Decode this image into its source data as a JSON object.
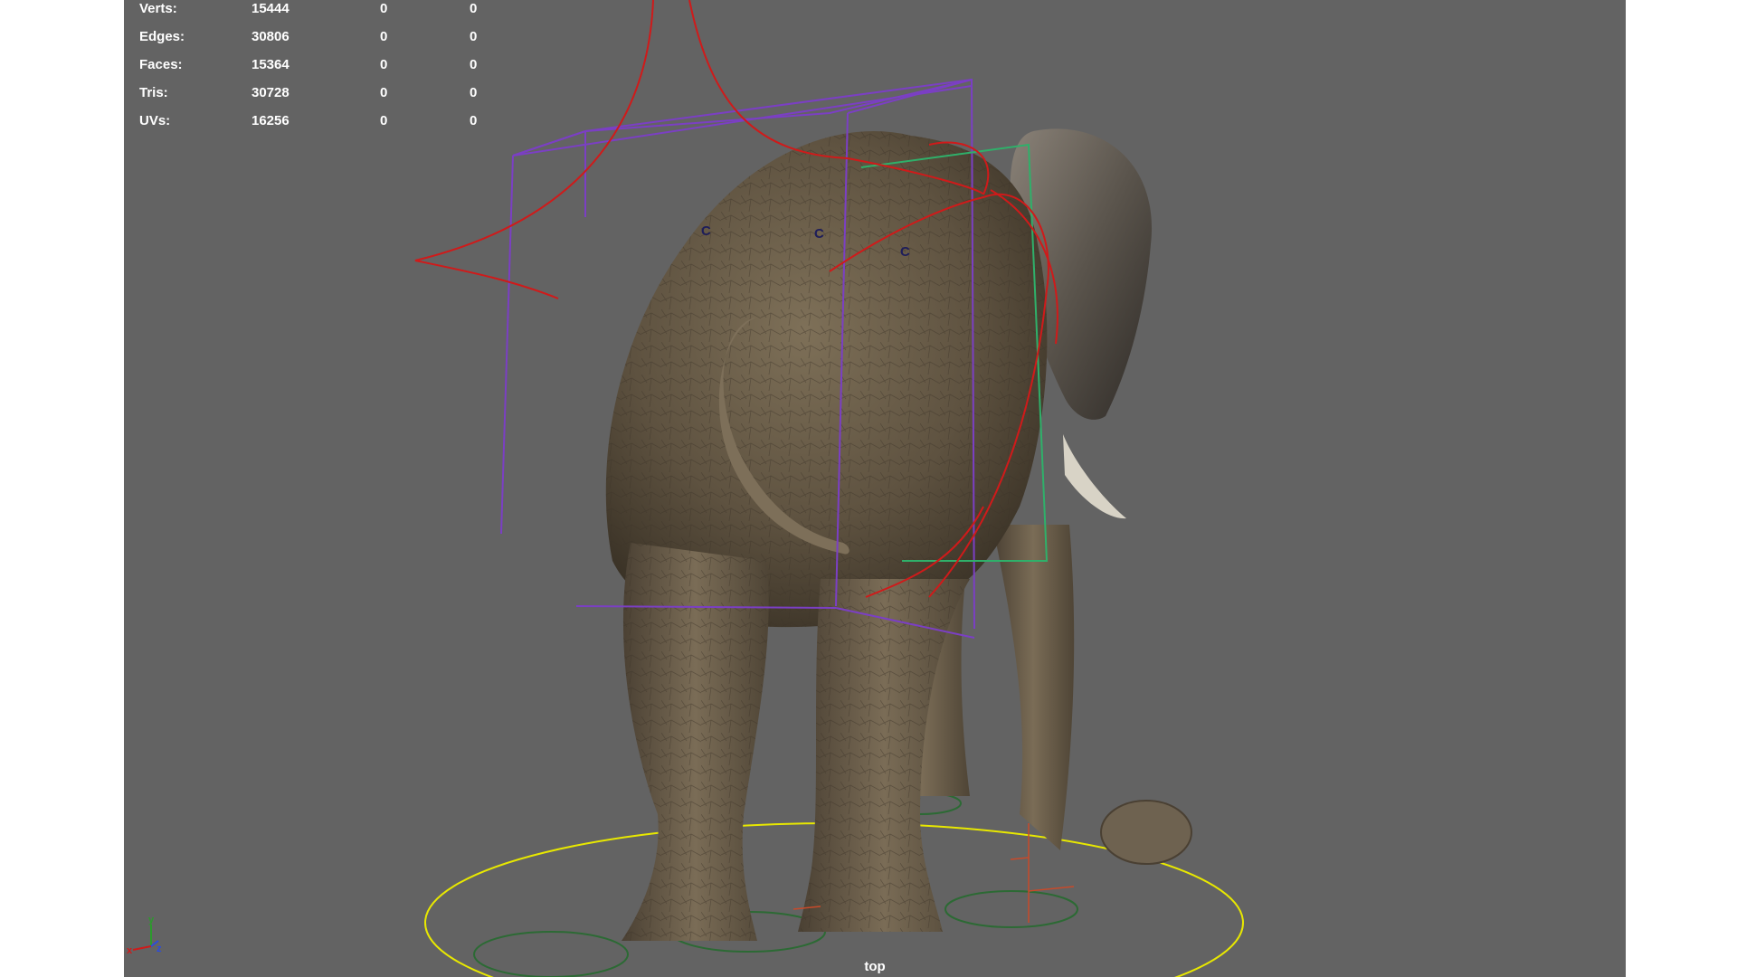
{
  "hud": {
    "rows": [
      {
        "label": "Verts:",
        "count": "15444",
        "sel1": "0",
        "sel2": "0"
      },
      {
        "label": "Edges:",
        "count": "30806",
        "sel1": "0",
        "sel2": "0"
      },
      {
        "label": "Faces:",
        "count": "15364",
        "sel1": "0",
        "sel2": "0"
      },
      {
        "label": "Tris:",
        "count": "30728",
        "sel1": "0",
        "sel2": "0"
      },
      {
        "label": "UVs:",
        "count": "16256",
        "sel1": "0",
        "sel2": "0"
      }
    ]
  },
  "controls": {
    "c1": "C",
    "c2": "C",
    "c3": "C"
  },
  "axes": {
    "x": "x",
    "y": "y",
    "z": "z"
  },
  "camera_label": "top",
  "colors": {
    "viewport_bg": "#636363",
    "root_circle": "#e8e800",
    "rig_curve": "#d01a1a",
    "bounding_box": "#7b3fc4",
    "locator": "#2c6a34",
    "hud_text": "#ffffff"
  }
}
